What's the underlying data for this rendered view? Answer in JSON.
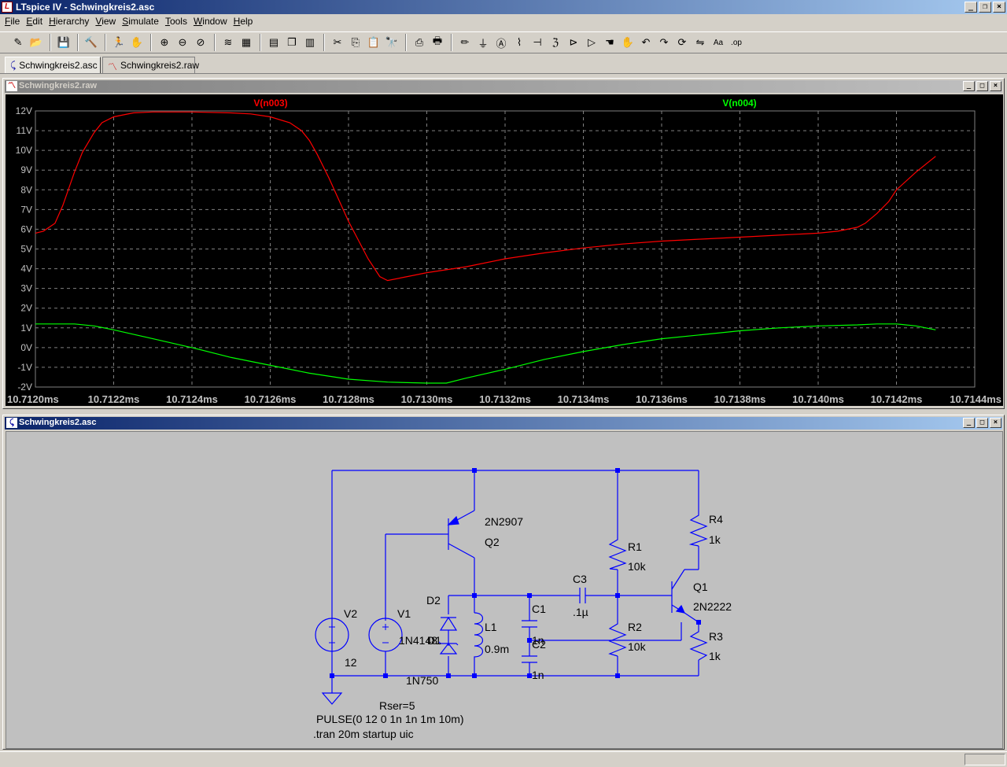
{
  "app": {
    "title": "LTspice IV - Schwingkreis2.asc",
    "icon": "ltspice-icon",
    "window_buttons": [
      "_",
      "❐",
      "×"
    ]
  },
  "menu": [
    {
      "label": "File",
      "accel": "F",
      "rest": "ile"
    },
    {
      "label": "Edit",
      "accel": "E",
      "rest": "dit"
    },
    {
      "label": "Hierarchy",
      "accel": "H",
      "rest": "ierarchy"
    },
    {
      "label": "View",
      "accel": "V",
      "rest": "iew"
    },
    {
      "label": "Simulate",
      "accel": "S",
      "rest": "imulate"
    },
    {
      "label": "Tools",
      "accel": "T",
      "rest": "ools"
    },
    {
      "label": "Window",
      "accel": "W",
      "rest": "indow"
    },
    {
      "label": "Help",
      "accel": "H",
      "rest": "elp"
    }
  ],
  "toolbar_icons": [
    [
      "new-schematic-icon",
      "open-icon"
    ],
    [
      "save-icon"
    ],
    [
      "control-panel-icon"
    ],
    [
      "run-icon",
      "halt-icon"
    ],
    [
      "zoom-in-icon",
      "zoom-out-icon",
      "zoom-fit-icon"
    ],
    [
      "autorange-icon",
      "grid-icon"
    ],
    [
      "tile-horizontal-icon",
      "cascade-icon",
      "tile-vertical-icon"
    ],
    [
      "cut-icon",
      "copy-icon",
      "paste-icon",
      "find-icon"
    ],
    [
      "print-setup-icon",
      "print-icon"
    ],
    [
      "draw-wire-icon",
      "ground-icon",
      "label-net-icon",
      "resistor-icon",
      "capacitor-icon",
      "inductor-icon",
      "diode-icon",
      "component-icon",
      "move-icon",
      "drag-icon",
      "undo-icon",
      "redo-icon",
      "rotate-icon",
      "mirror-icon",
      "text-icon",
      "spice-directive-icon"
    ]
  ],
  "tabs": [
    {
      "label": "Schwingkreis2.asc",
      "icon": "schematic-icon",
      "active": true
    },
    {
      "label": "Schwingkreis2.raw",
      "icon": "waveform-icon",
      "active": false
    }
  ],
  "plot_window": {
    "title": "Schwingkreis2.raw",
    "window_buttons": [
      "_",
      "□",
      "×"
    ]
  },
  "schematic_window": {
    "title": "Schwingkreis2.asc",
    "window_buttons": [
      "_",
      "□",
      "×"
    ]
  },
  "chart_data": {
    "type": "line",
    "title": "",
    "xlabel": "",
    "ylabel": "",
    "x_unit": "ms",
    "y_unit": "V",
    "xlim": [
      10.712,
      10.7144
    ],
    "ylim": [
      -2,
      12
    ],
    "x_ticks": [
      "10.7120ms",
      "10.7122ms",
      "10.7124ms",
      "10.7126ms",
      "10.7128ms",
      "10.7130ms",
      "10.7132ms",
      "10.7134ms",
      "10.7136ms",
      "10.7138ms",
      "10.7140ms",
      "10.7142ms",
      "10.7144ms"
    ],
    "y_ticks": [
      "12V",
      "11V",
      "10V",
      "9V",
      "8V",
      "7V",
      "6V",
      "5V",
      "4V",
      "3V",
      "2V",
      "1V",
      "0V",
      "-1V",
      "-2V"
    ],
    "grid": true,
    "legend": "top",
    "series": [
      {
        "name": "V(n003)",
        "color": "#ff0000",
        "points": [
          [
            10.712,
            5.8
          ],
          [
            10.71202,
            5.9
          ],
          [
            10.71205,
            6.3
          ],
          [
            10.71207,
            7.2
          ],
          [
            10.7121,
            8.9
          ],
          [
            10.71212,
            9.9
          ],
          [
            10.71215,
            10.9
          ],
          [
            10.71217,
            11.4
          ],
          [
            10.7122,
            11.7
          ],
          [
            10.71225,
            11.9
          ],
          [
            10.7123,
            11.95
          ],
          [
            10.7124,
            11.95
          ],
          [
            10.7125,
            11.9
          ],
          [
            10.71255,
            11.85
          ],
          [
            10.7126,
            11.7
          ],
          [
            10.71265,
            11.4
          ],
          [
            10.71268,
            11.0
          ],
          [
            10.7127,
            10.5
          ],
          [
            10.71272,
            9.8
          ],
          [
            10.71275,
            8.6
          ],
          [
            10.7128,
            6.4
          ],
          [
            10.71285,
            4.5
          ],
          [
            10.71288,
            3.6
          ],
          [
            10.7129,
            3.4
          ],
          [
            10.71295,
            3.6
          ],
          [
            10.713,
            3.8
          ],
          [
            10.7131,
            4.1
          ],
          [
            10.7132,
            4.5
          ],
          [
            10.7133,
            4.8
          ],
          [
            10.7134,
            5.05
          ],
          [
            10.7135,
            5.25
          ],
          [
            10.7136,
            5.4
          ],
          [
            10.7137,
            5.5
          ],
          [
            10.7138,
            5.6
          ],
          [
            10.7139,
            5.7
          ],
          [
            10.714,
            5.8
          ],
          [
            10.71405,
            5.9
          ],
          [
            10.7141,
            6.1
          ],
          [
            10.71412,
            6.3
          ],
          [
            10.71415,
            6.8
          ],
          [
            10.71418,
            7.4
          ],
          [
            10.7142,
            8.0
          ],
          [
            10.71425,
            8.9
          ],
          [
            10.7143,
            9.7
          ]
        ]
      },
      {
        "name": "V(n004)",
        "color": "#00ff00",
        "points": [
          [
            10.712,
            1.2
          ],
          [
            10.71205,
            1.2
          ],
          [
            10.7121,
            1.2
          ],
          [
            10.71215,
            1.1
          ],
          [
            10.7122,
            0.9
          ],
          [
            10.7123,
            0.45
          ],
          [
            10.7124,
            0.0
          ],
          [
            10.7125,
            -0.5
          ],
          [
            10.7126,
            -0.9
          ],
          [
            10.7127,
            -1.3
          ],
          [
            10.7128,
            -1.6
          ],
          [
            10.7129,
            -1.75
          ],
          [
            10.713,
            -1.8
          ],
          [
            10.71305,
            -1.8
          ],
          [
            10.7131,
            -1.55
          ],
          [
            10.7132,
            -1.1
          ],
          [
            10.7133,
            -0.6
          ],
          [
            10.7134,
            -0.2
          ],
          [
            10.7135,
            0.15
          ],
          [
            10.7136,
            0.45
          ],
          [
            10.7137,
            0.65
          ],
          [
            10.7138,
            0.85
          ],
          [
            10.7139,
            1.0
          ],
          [
            10.714,
            1.1
          ],
          [
            10.7141,
            1.15
          ],
          [
            10.71415,
            1.2
          ],
          [
            10.7142,
            1.2
          ],
          [
            10.71425,
            1.1
          ],
          [
            10.7143,
            0.9
          ]
        ]
      }
    ]
  },
  "schematic": {
    "components": {
      "q2_name": "2N2907",
      "q2_ref": "Q2",
      "q1_ref": "Q1",
      "q1_name": "2N2222",
      "r4_ref": "R4",
      "r4_val": "1k",
      "r1_ref": "R1",
      "r1_val": "10k",
      "r2_ref": "R2",
      "r2_val": "10k",
      "r3_ref": "R3",
      "r3_val": "1k",
      "c3_ref": "C3",
      "c3_val": ".1µ",
      "c1_ref": "C1",
      "c1_val": "1n",
      "c2_ref": "C2",
      "c2_val": "1n",
      "l1_ref": "L1",
      "l1_val": "0.9m",
      "d2_ref": "D2",
      "d1_overlap": "1N4148",
      "d1_ref": "D1",
      "d3_val": "1N750",
      "v2_ref": "V2",
      "v2_val": "12",
      "v1_ref": "V1"
    },
    "directives": {
      "rser": "Rser=5",
      "pulse": "PULSE(0 12 0 1n 1n 1m 10m)",
      "tran": ".tran 20m startup uic"
    }
  }
}
